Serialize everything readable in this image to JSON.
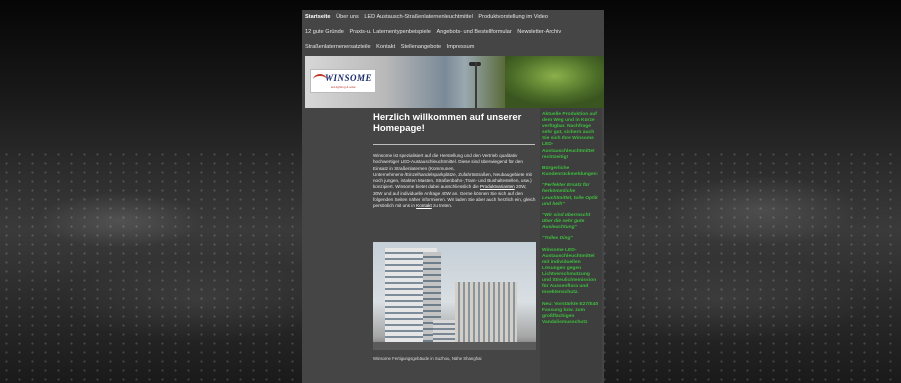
{
  "nav": {
    "row1": [
      "Startseite",
      "Über uns",
      "LED Austausch-Straßenlaternenleuchtmittel",
      "Produktvorstellung im Video"
    ],
    "row2": [
      "12 gute Gründe",
      "Praxis-u. Laternentypenbeispiele",
      "Angebots- und Bestellformular",
      "Newsletter-Archiv"
    ],
    "row3": [
      "Straßenlaternenersatzteile",
      "Kontakt",
      "Stellenangebote",
      "Impressum"
    ],
    "active": "Startseite"
  },
  "logo": {
    "text": "WINSOME",
    "sub": "led-lighting & solar"
  },
  "main": {
    "heading": "Herzlich willkommen auf unserer Homepage!",
    "paragraph_pre": "Winsome ist spezialisiert auf die Herstellung und den Vertrieb qualitativ hochwertiger LED-Austauschleuchtmittel. Diese sind überwiegend für den Einsatz in Straßenlaternen (Kommunen, Unternehmens-/Einzelhandelsparkplätze, Zufahrtsstraßen, Neubaugebiete mit noch jungen, intakten Masten, Straßenbahn-,Tram- und Bushaltestellen, usw.) konzipiert. Winsome bietet dabei ausschliesslich die",
    "link1": "Produktvarianten",
    "paragraph_mid": "20W, 30W und auf individuelle Anfrage 40W an. Gerne können Sie sich auf den folgenden Seiten näher informieren. Wir laden Sie aber auch herzlich ein, gleich persönlich mit uns in",
    "link2": "Kontakt",
    "paragraph_end": "zu treten.",
    "caption": "Winsome Fertigungsgebäude in Suzhou, Nähe Shanghai"
  },
  "sidebar": {
    "blocks": [
      {
        "text": "Aktuelle Produktion auf dem Weg und in Kürze verfügbar. Nachfrage sehr gut, sichern auch Sie sich Ihre Winsome LED-Austauschleuchtmittel rechtzeitig!",
        "italic": false
      },
      {
        "text": "Bürgerliche Kundenrückmeldungen:",
        "italic": false
      },
      {
        "text": "\"Perfekter Ersatz für herkömmliche Leuchtmittel, tolle Optik und hell!\"",
        "italic": true
      },
      {
        "text": "\"Wir sind überrascht über die sehr gute Ausleuchtung\"",
        "italic": true
      },
      {
        "text": "\"Tolles Ding\"",
        "italic": true
      },
      {
        "text": "Winsome LED-Austauschleuchtmittel mit individuellen Lösungen gegen Lichtverschmutzung und Streulichtemission für Aussenflora und Insektenschutz.",
        "italic": false
      },
      {
        "text": "Neu: Vorstärkte E27/E40 Fassung bzw. zum großflächigen Vandalismusschutz",
        "italic": false
      }
    ]
  },
  "colors": {
    "page_bg": "#454545",
    "sidebar_text": "#3fbf3f",
    "heading": "#ffffff"
  }
}
